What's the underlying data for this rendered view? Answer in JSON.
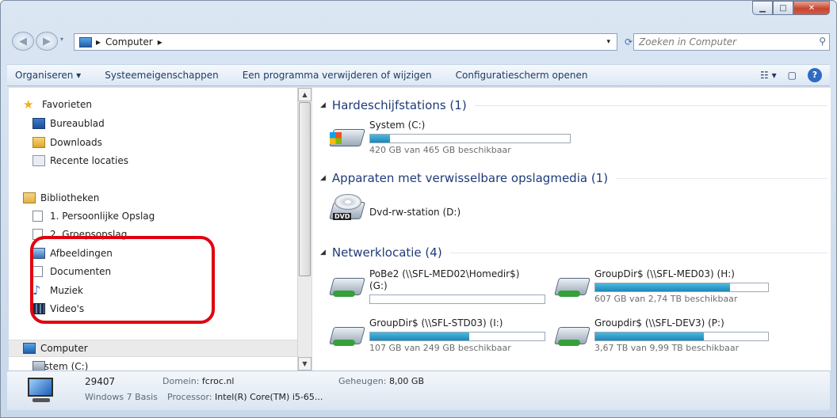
{
  "address": {
    "crumb": "Computer",
    "search_placeholder": "Zoeken in Computer"
  },
  "toolbar": {
    "organize": "Organiseren ▾",
    "system_props": "Systeemeigenschappen",
    "uninstall": "Een programma verwijderen of wijzigen",
    "control_panel": "Configuratiescherm openen"
  },
  "nav": {
    "favorites": "Favorieten",
    "desktop": "Bureaublad",
    "downloads": "Downloads",
    "recent": "Recente locaties",
    "libraries": "Bibliotheken",
    "lib1": "1. Persoonlijke Opslag",
    "lib2": "2. Groepsopslag",
    "pictures": "Afbeeldingen",
    "documents": "Documenten",
    "music": "Muziek",
    "videos": "Video's",
    "computer": "Computer",
    "system_c": "System (C:)"
  },
  "groups": {
    "hdd": "Hardeschijfstations (1)",
    "removable": "Apparaten met verwisselbare opslagmedia (1)",
    "network": "Netwerklocatie (4)"
  },
  "drives": {
    "c": {
      "name": "System (C:)",
      "size": "420 GB van 465 GB beschikbaar",
      "used_fraction": 0.1
    },
    "d": {
      "name": "Dvd-rw-station (D:)"
    },
    "g": {
      "name": "PoBe2 (\\\\SFL-MED02\\Homedir$)",
      "name2": "(G:)",
      "used_fraction": 0.0
    },
    "h": {
      "name": "GroupDir$ (\\\\SFL-MED03) (H:)",
      "size": "607 GB van 2,74 TB beschikbaar",
      "used_fraction": 0.78
    },
    "i": {
      "name": "GroupDir$ (\\\\SFL-STD03) (I:)",
      "size": "107 GB van 249 GB beschikbaar",
      "used_fraction": 0.57
    },
    "p": {
      "name": "Groupdir$ (\\\\SFL-DEV3) (P:)",
      "size": "3,67 TB van 9,99 TB beschikbaar",
      "used_fraction": 0.63
    }
  },
  "details": {
    "name": "29407",
    "os": "Windows 7 Basis",
    "domain_label": "Domein:",
    "domain": "fcroc.nl",
    "processor_label": "Processor:",
    "processor": "Intel(R) Core(TM) i5-65...",
    "memory_label": "Geheugen:",
    "memory": "8,00 GB"
  },
  "colors": {
    "highlight": "#e2000f",
    "bar_fill": "#2a96c8",
    "group_header": "#1e3b78"
  }
}
